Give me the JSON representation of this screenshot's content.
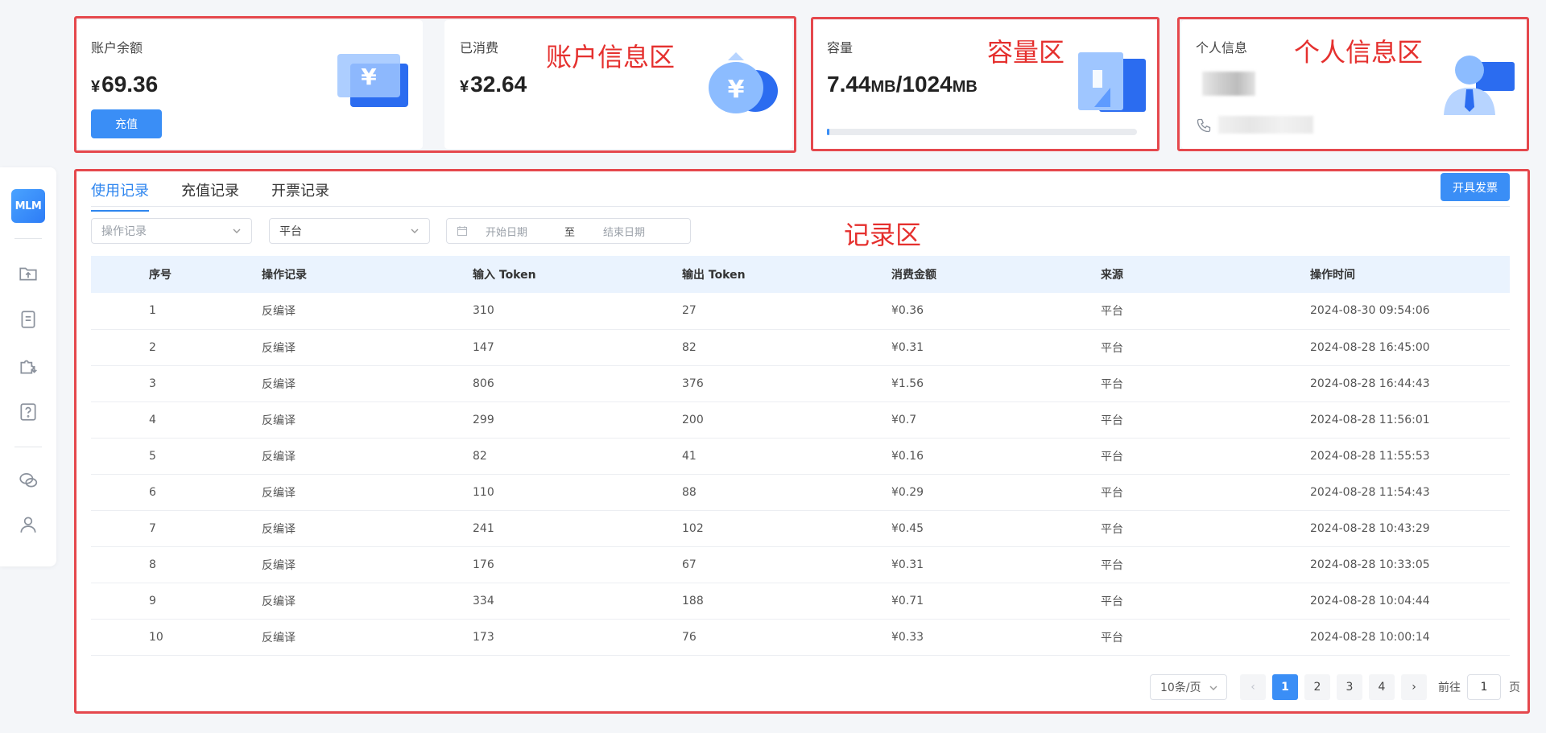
{
  "sidebar": {
    "logo": "MLM",
    "icons": [
      "folder-upload-icon",
      "document-icon",
      "puzzle-download-icon",
      "help-icon",
      "wechat-icon",
      "user-icon"
    ]
  },
  "cards": {
    "balance": {
      "label": "账户余额",
      "currency": "¥",
      "value": "69.36",
      "button": "充值"
    },
    "spent": {
      "label": "已消费",
      "currency": "¥",
      "value": "32.64"
    },
    "capacity": {
      "label": "容量",
      "used": "7.44",
      "used_unit": "MB",
      "sep": "/",
      "total": "1024",
      "total_unit": "MB",
      "progress": 0.007
    },
    "profile": {
      "label": "个人信息"
    }
  },
  "zones": {
    "account": "账户信息区",
    "capacity": "容量区",
    "profile": "个人信息区",
    "records": "记录区"
  },
  "records": {
    "tabs": [
      "使用记录",
      "充值记录",
      "开票记录"
    ],
    "invoice_button": "开具发票",
    "filters": {
      "operation_placeholder": "操作记录",
      "platform_value": "平台",
      "start_date": "开始日期",
      "to": "至",
      "end_date": "结束日期"
    },
    "columns": [
      "序号",
      "操作记录",
      "输入 Token",
      "输出 Token",
      "消费金额",
      "来源",
      "操作时间"
    ],
    "rows": [
      [
        "1",
        "反编译",
        "310",
        "27",
        "¥0.36",
        "平台",
        "2024-08-30 09:54:06"
      ],
      [
        "2",
        "反编译",
        "147",
        "82",
        "¥0.31",
        "平台",
        "2024-08-28 16:45:00"
      ],
      [
        "3",
        "反编译",
        "806",
        "376",
        "¥1.56",
        "平台",
        "2024-08-28 16:44:43"
      ],
      [
        "4",
        "反编译",
        "299",
        "200",
        "¥0.7",
        "平台",
        "2024-08-28 11:56:01"
      ],
      [
        "5",
        "反编译",
        "82",
        "41",
        "¥0.16",
        "平台",
        "2024-08-28 11:55:53"
      ],
      [
        "6",
        "反编译",
        "110",
        "88",
        "¥0.29",
        "平台",
        "2024-08-28 11:54:43"
      ],
      [
        "7",
        "反编译",
        "241",
        "102",
        "¥0.45",
        "平台",
        "2024-08-28 10:43:29"
      ],
      [
        "8",
        "反编译",
        "176",
        "67",
        "¥0.31",
        "平台",
        "2024-08-28 10:33:05"
      ],
      [
        "9",
        "反编译",
        "334",
        "188",
        "¥0.71",
        "平台",
        "2024-08-28 10:04:44"
      ],
      [
        "10",
        "反编译",
        "173",
        "76",
        "¥0.33",
        "平台",
        "2024-08-28 10:00:14"
      ]
    ],
    "pagination": {
      "page_size": "10条/页",
      "pages": [
        "1",
        "2",
        "3",
        "4"
      ],
      "current": "1",
      "goto_label": "前往",
      "goto_value": "1",
      "page_suffix": "页"
    }
  },
  "colors": {
    "accent": "#3a8ef6",
    "annotation": "#e5302e"
  }
}
